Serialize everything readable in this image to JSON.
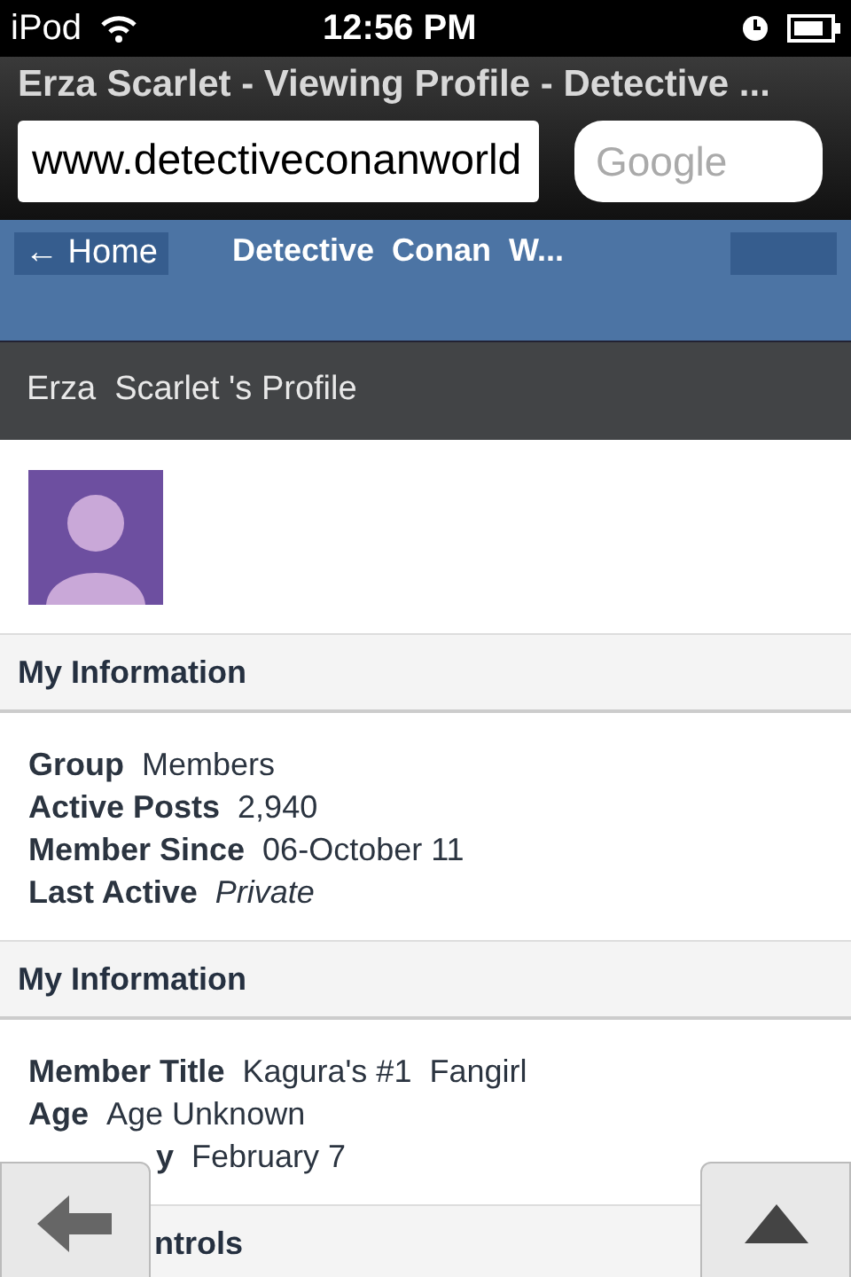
{
  "status_bar": {
    "device": "iPod",
    "time": "12:56 PM"
  },
  "browser": {
    "title": "Erza Scarlet - Viewing Profile - Detective ...",
    "url": "www.detectiveconanworld",
    "search": {
      "placeholder": "Google"
    }
  },
  "site_header": {
    "back_button": "← Home",
    "title": "Detective  Conan  W..."
  },
  "profile_bar": {
    "title": "Erza  Scarlet 's Profile"
  },
  "sections": [
    {
      "heading": "My Information",
      "fields": [
        {
          "label": "Group",
          "value": "Members",
          "italic": false
        },
        {
          "label": "Active Posts",
          "value": "2,940",
          "italic": false
        },
        {
          "label": "Member Since",
          "value": "06-October 11",
          "italic": false
        },
        {
          "label": "Last Active",
          "value": "Private",
          "italic": true
        }
      ]
    },
    {
      "heading": "My Information",
      "fields": [
        {
          "label": "Member Title",
          "value": "Kagura's #1  Fangirl",
          "italic": false
        },
        {
          "label": "Age",
          "value": "Age Unknown",
          "italic": false
        },
        {
          "label": "y",
          "value": "February 7",
          "italic": false,
          "covered": true
        }
      ]
    },
    {
      "heading": "ntrols",
      "covered": true
    }
  ]
}
